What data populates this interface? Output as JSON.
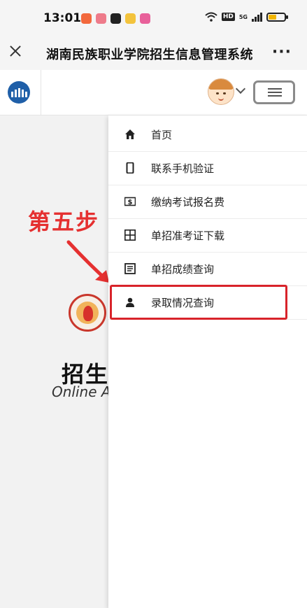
{
  "status_bar": {
    "time": "13:01",
    "network_badge": "HD",
    "signal_label": "5G",
    "battery_level": 0.45
  },
  "title_bar": {
    "title": "湖南民族职业学院招生信息管理系统",
    "more_label": "···"
  },
  "menu": {
    "items": [
      {
        "label": "首页",
        "icon": "home-icon"
      },
      {
        "label": "联系手机验证",
        "icon": "phone-icon"
      },
      {
        "label": "缴纳考试报名费",
        "icon": "dollar-icon"
      },
      {
        "label": "单招准考证下载",
        "icon": "grid-icon"
      },
      {
        "label": "单招成绩查询",
        "icon": "document-icon"
      },
      {
        "label": "录取情况查询",
        "icon": "person-icon"
      }
    ],
    "highlighted_index": 5
  },
  "annotation": {
    "text": "第五步",
    "color": "#e53030"
  },
  "background_page": {
    "title_partial": "招生",
    "subtitle_partial": "Online A"
  },
  "colors": {
    "accent_red": "#d8232a",
    "logo_blue": "#1f5fa8"
  }
}
